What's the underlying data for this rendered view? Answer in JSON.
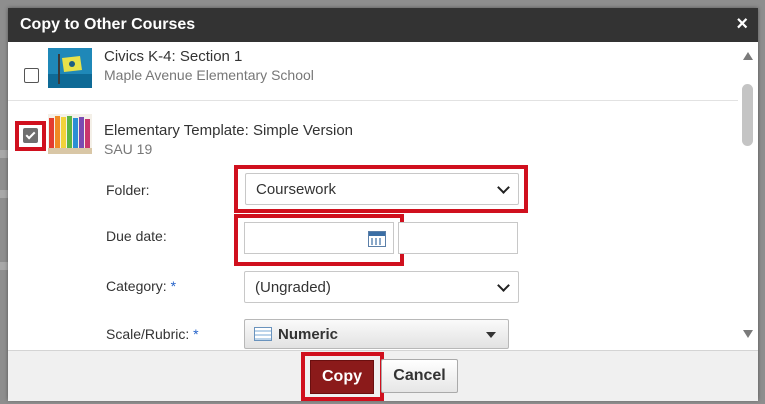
{
  "dialog": {
    "title": "Copy to Other Courses",
    "close_symbol": "×"
  },
  "courses": [
    {
      "name": "Civics K-4: Section 1",
      "school": "Maple Avenue Elementary School",
      "checked": false,
      "thumb": "flag-thumbnail"
    },
    {
      "name": "Elementary Template: Simple Version",
      "school": "SAU 19",
      "checked": true,
      "thumb": "colored-pencils-thumbnail"
    }
  ],
  "form": {
    "folder_label": "Folder:",
    "folder_value": "Coursework",
    "due_date_label": "Due date:",
    "due_date_value": "",
    "category_label": "Category:",
    "category_value": "(Ungraded)",
    "scale_label": "Scale/Rubric:",
    "scale_value": "Numeric",
    "required_mark": "*"
  },
  "footer": {
    "copy_label": "Copy",
    "cancel_label": "Cancel"
  },
  "colors": {
    "titlebar": "#333333",
    "highlight": "#d0101e",
    "copy_button": "#8b1a1a",
    "required": "#2563c9"
  }
}
